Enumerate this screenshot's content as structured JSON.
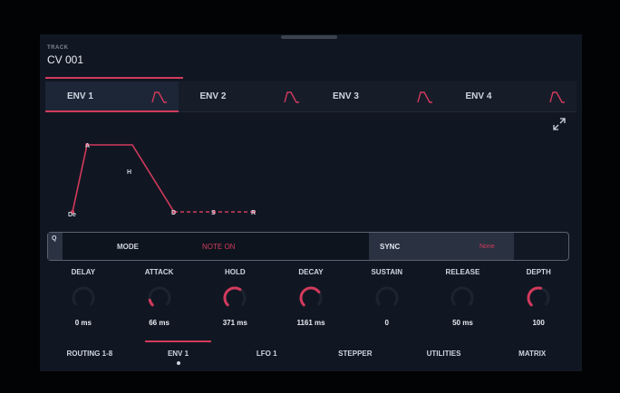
{
  "track": {
    "label": "TRACK",
    "name": "CV 001"
  },
  "env_tabs": [
    {
      "label": "ENV 1",
      "icon": "envelope-shape-icon",
      "active": true
    },
    {
      "label": "ENV 2",
      "icon": "envelope-shape-icon",
      "active": false
    },
    {
      "label": "ENV 3",
      "icon": "envelope-shape-icon",
      "active": false
    },
    {
      "label": "ENV 4",
      "icon": "envelope-shape-icon",
      "active": false
    }
  ],
  "graph": {
    "points": {
      "delay": "De",
      "attack": "A",
      "hold": "H",
      "decay": "D",
      "sustain": "S",
      "release": "R"
    },
    "line_color": "#d23a5c"
  },
  "mode_bar": {
    "q_label": "Q",
    "mode_label": "MODE",
    "mode_value": "NOTE ON",
    "sync_label": "SYNC",
    "sync_value": "None"
  },
  "knobs": [
    {
      "label": "DELAY",
      "value": "0 ms",
      "level": 0.0
    },
    {
      "label": "ATTACK",
      "value": "66 ms",
      "level": 0.12
    },
    {
      "label": "HOLD",
      "value": "371 ms",
      "level": 0.62
    },
    {
      "label": "DECAY",
      "value": "1161 ms",
      "level": 0.7
    },
    {
      "label": "SUSTAIN",
      "value": "0",
      "level": 0.0
    },
    {
      "label": "RELEASE",
      "value": "50 ms",
      "level": 0.0
    },
    {
      "label": "DEPTH",
      "value": "100",
      "level": 0.55
    }
  ],
  "bottom_nav": [
    {
      "label": "ROUTING 1-8",
      "active": false
    },
    {
      "label": "ENV 1",
      "active": true
    },
    {
      "label": "LFO 1",
      "active": false
    },
    {
      "label": "STEPPER",
      "active": false
    },
    {
      "label": "UTILITIES",
      "active": false
    },
    {
      "label": "MATRIX",
      "active": false
    }
  ],
  "colors": {
    "accent": "#d23a5c",
    "background": "#111722",
    "text": "#dfe6ef"
  }
}
